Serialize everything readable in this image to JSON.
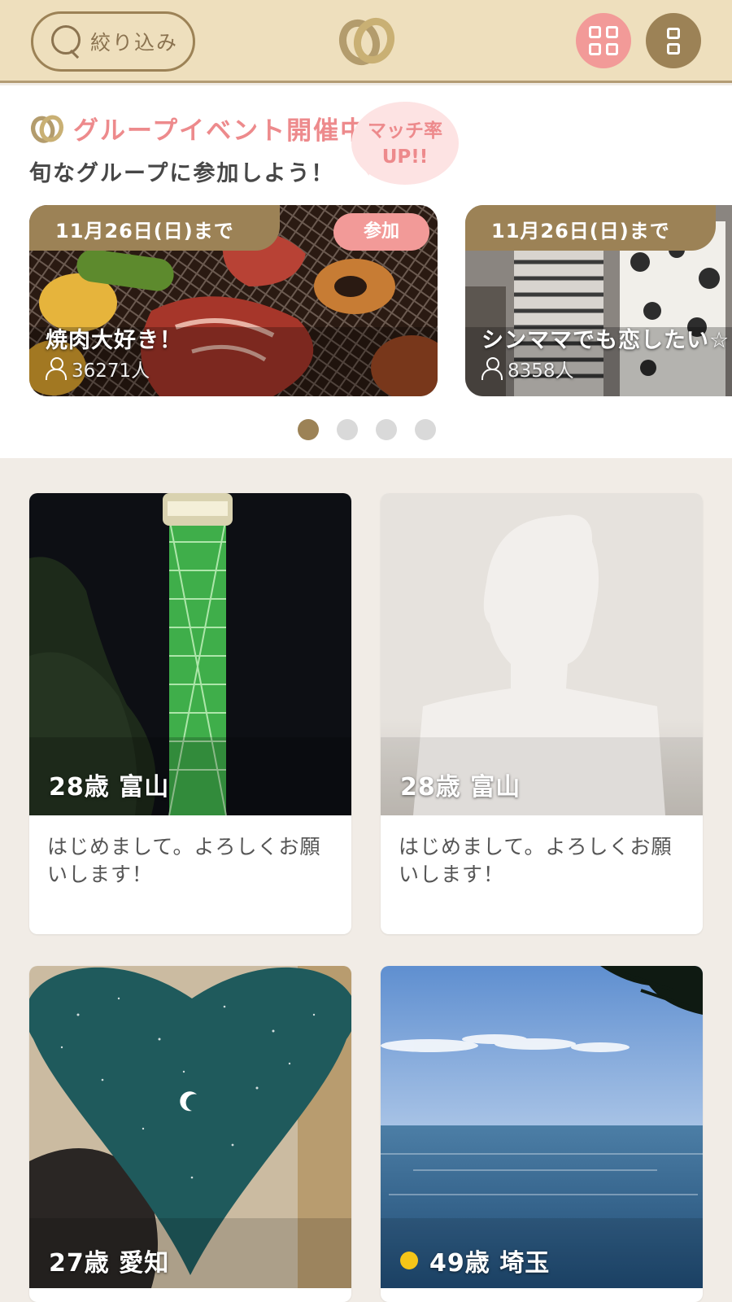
{
  "header": {
    "filter_label": "絞り込み"
  },
  "event_banner": {
    "title": "グループイベント開催中",
    "subtitle": "旬なグループに参加しよう！",
    "badge_line1": "マッチ率",
    "badge_line2": "UP!!",
    "cards": [
      {
        "date": "11月26日(日)まで",
        "join_label": "参加",
        "name": "焼肉大好き！",
        "count": "36271人"
      },
      {
        "date": "11月26日(日)まで",
        "name": "シンママでも恋したい☆",
        "count": "8358人"
      }
    ],
    "pagination": {
      "total": 4,
      "active": 1
    }
  },
  "profiles": [
    {
      "age_location": "28歳 富山",
      "message": "はじめまして。よろしくお願いします！"
    },
    {
      "age_location": "28歳 富山",
      "message": "はじめまして。よろしくお願いします！"
    },
    {
      "age_location": "27歳 愛知"
    },
    {
      "age_location": "49歳 埼玉",
      "online": true
    }
  ],
  "colors": {
    "header_bg": "#eedfbd",
    "brand_brown": "#9c8256",
    "accent_pink": "#f29a98",
    "online": "#f5c518"
  }
}
